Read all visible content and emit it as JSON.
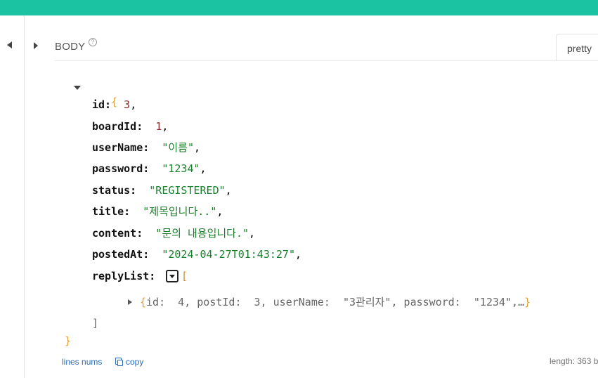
{
  "header": {
    "body_label": "BODY",
    "help_glyph": "?",
    "view_mode": "pretty"
  },
  "json": {
    "open_brace": "{",
    "close_brace": "}",
    "fields": [
      {
        "key": "id:",
        "value": "3",
        "type": "num"
      },
      {
        "key": "boardId:",
        "value": "1",
        "type": "num"
      },
      {
        "key": "userName:",
        "value": "\"이름\"",
        "type": "str"
      },
      {
        "key": "password:",
        "value": "\"1234\"",
        "type": "str"
      },
      {
        "key": "status:",
        "value": "\"REGISTERED\"",
        "type": "str"
      },
      {
        "key": "title:",
        "value": "\"제목입니다..\"",
        "type": "str"
      },
      {
        "key": "content:",
        "value": "\"문의 내용입니다.\"",
        "type": "str"
      },
      {
        "key": "postedAt:",
        "value": "\"2024-04-27T01:43:27\"",
        "type": "str"
      }
    ],
    "reply_list_key": "replyList:",
    "open_bracket": "[",
    "close_bracket": "]",
    "collapsed_item": {
      "open": "{",
      "text": "id:  4, postId:  3, userName:  \"3관리자\", password:  \"1234\",…",
      "close": "}"
    },
    "comma": ","
  },
  "footer": {
    "line_nums_label": "lines nums",
    "copy_label": "copy",
    "length_label": "length: 363 b"
  },
  "colors": {
    "topbar": "#1bc3a3",
    "key": "#111111",
    "number": "#8b2a2a",
    "string": "#1a7f2a",
    "brace": "#e0a030",
    "link": "#2a6db5"
  }
}
